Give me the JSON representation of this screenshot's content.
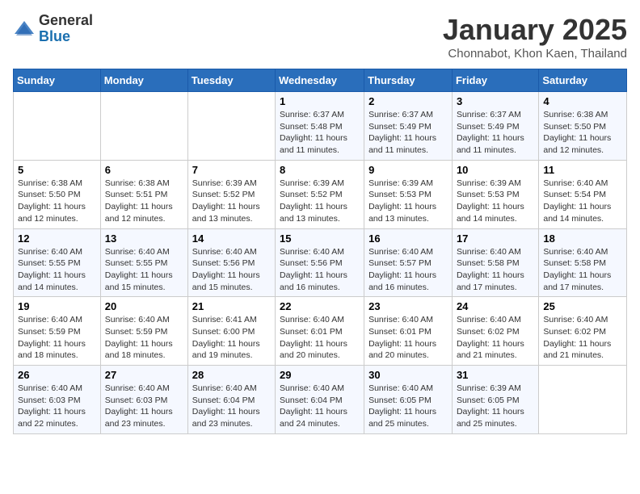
{
  "header": {
    "logo_general": "General",
    "logo_blue": "Blue",
    "month": "January 2025",
    "location": "Chonnabot, Khon Kaen, Thailand"
  },
  "weekdays": [
    "Sunday",
    "Monday",
    "Tuesday",
    "Wednesday",
    "Thursday",
    "Friday",
    "Saturday"
  ],
  "weeks": [
    [
      {
        "day": "",
        "info": ""
      },
      {
        "day": "",
        "info": ""
      },
      {
        "day": "",
        "info": ""
      },
      {
        "day": "1",
        "info": "Sunrise: 6:37 AM\nSunset: 5:48 PM\nDaylight: 11 hours and 11 minutes."
      },
      {
        "day": "2",
        "info": "Sunrise: 6:37 AM\nSunset: 5:49 PM\nDaylight: 11 hours and 11 minutes."
      },
      {
        "day": "3",
        "info": "Sunrise: 6:37 AM\nSunset: 5:49 PM\nDaylight: 11 hours and 11 minutes."
      },
      {
        "day": "4",
        "info": "Sunrise: 6:38 AM\nSunset: 5:50 PM\nDaylight: 11 hours and 12 minutes."
      }
    ],
    [
      {
        "day": "5",
        "info": "Sunrise: 6:38 AM\nSunset: 5:50 PM\nDaylight: 11 hours and 12 minutes."
      },
      {
        "day": "6",
        "info": "Sunrise: 6:38 AM\nSunset: 5:51 PM\nDaylight: 11 hours and 12 minutes."
      },
      {
        "day": "7",
        "info": "Sunrise: 6:39 AM\nSunset: 5:52 PM\nDaylight: 11 hours and 13 minutes."
      },
      {
        "day": "8",
        "info": "Sunrise: 6:39 AM\nSunset: 5:52 PM\nDaylight: 11 hours and 13 minutes."
      },
      {
        "day": "9",
        "info": "Sunrise: 6:39 AM\nSunset: 5:53 PM\nDaylight: 11 hours and 13 minutes."
      },
      {
        "day": "10",
        "info": "Sunrise: 6:39 AM\nSunset: 5:53 PM\nDaylight: 11 hours and 14 minutes."
      },
      {
        "day": "11",
        "info": "Sunrise: 6:40 AM\nSunset: 5:54 PM\nDaylight: 11 hours and 14 minutes."
      }
    ],
    [
      {
        "day": "12",
        "info": "Sunrise: 6:40 AM\nSunset: 5:55 PM\nDaylight: 11 hours and 14 minutes."
      },
      {
        "day": "13",
        "info": "Sunrise: 6:40 AM\nSunset: 5:55 PM\nDaylight: 11 hours and 15 minutes."
      },
      {
        "day": "14",
        "info": "Sunrise: 6:40 AM\nSunset: 5:56 PM\nDaylight: 11 hours and 15 minutes."
      },
      {
        "day": "15",
        "info": "Sunrise: 6:40 AM\nSunset: 5:56 PM\nDaylight: 11 hours and 16 minutes."
      },
      {
        "day": "16",
        "info": "Sunrise: 6:40 AM\nSunset: 5:57 PM\nDaylight: 11 hours and 16 minutes."
      },
      {
        "day": "17",
        "info": "Sunrise: 6:40 AM\nSunset: 5:58 PM\nDaylight: 11 hours and 17 minutes."
      },
      {
        "day": "18",
        "info": "Sunrise: 6:40 AM\nSunset: 5:58 PM\nDaylight: 11 hours and 17 minutes."
      }
    ],
    [
      {
        "day": "19",
        "info": "Sunrise: 6:40 AM\nSunset: 5:59 PM\nDaylight: 11 hours and 18 minutes."
      },
      {
        "day": "20",
        "info": "Sunrise: 6:40 AM\nSunset: 5:59 PM\nDaylight: 11 hours and 18 minutes."
      },
      {
        "day": "21",
        "info": "Sunrise: 6:41 AM\nSunset: 6:00 PM\nDaylight: 11 hours and 19 minutes."
      },
      {
        "day": "22",
        "info": "Sunrise: 6:40 AM\nSunset: 6:01 PM\nDaylight: 11 hours and 20 minutes."
      },
      {
        "day": "23",
        "info": "Sunrise: 6:40 AM\nSunset: 6:01 PM\nDaylight: 11 hours and 20 minutes."
      },
      {
        "day": "24",
        "info": "Sunrise: 6:40 AM\nSunset: 6:02 PM\nDaylight: 11 hours and 21 minutes."
      },
      {
        "day": "25",
        "info": "Sunrise: 6:40 AM\nSunset: 6:02 PM\nDaylight: 11 hours and 21 minutes."
      }
    ],
    [
      {
        "day": "26",
        "info": "Sunrise: 6:40 AM\nSunset: 6:03 PM\nDaylight: 11 hours and 22 minutes."
      },
      {
        "day": "27",
        "info": "Sunrise: 6:40 AM\nSunset: 6:03 PM\nDaylight: 11 hours and 23 minutes."
      },
      {
        "day": "28",
        "info": "Sunrise: 6:40 AM\nSunset: 6:04 PM\nDaylight: 11 hours and 23 minutes."
      },
      {
        "day": "29",
        "info": "Sunrise: 6:40 AM\nSunset: 6:04 PM\nDaylight: 11 hours and 24 minutes."
      },
      {
        "day": "30",
        "info": "Sunrise: 6:40 AM\nSunset: 6:05 PM\nDaylight: 11 hours and 25 minutes."
      },
      {
        "day": "31",
        "info": "Sunrise: 6:39 AM\nSunset: 6:05 PM\nDaylight: 11 hours and 25 minutes."
      },
      {
        "day": "",
        "info": ""
      }
    ]
  ]
}
